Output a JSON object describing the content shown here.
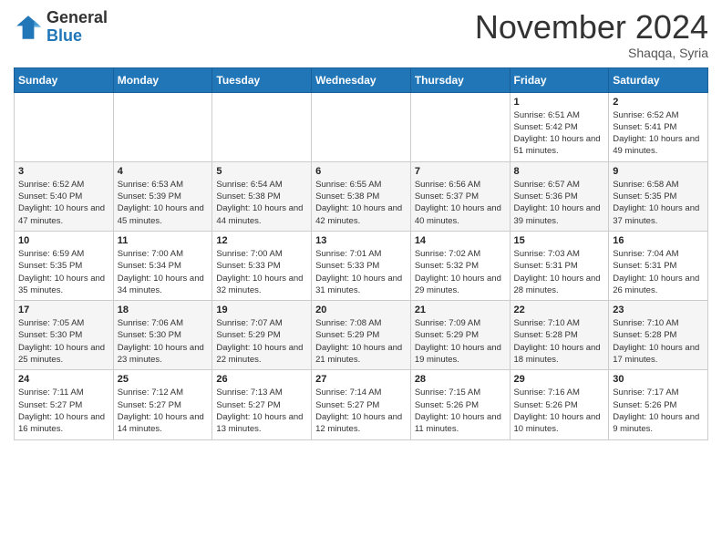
{
  "header": {
    "logo_line1": "General",
    "logo_line2": "Blue",
    "month": "November 2024",
    "location": "Shaqqa, Syria"
  },
  "weekdays": [
    "Sunday",
    "Monday",
    "Tuesday",
    "Wednesday",
    "Thursday",
    "Friday",
    "Saturday"
  ],
  "weeks": [
    [
      null,
      null,
      null,
      null,
      null,
      {
        "day": "1",
        "sunrise": "6:51 AM",
        "sunset": "5:42 PM",
        "daylight": "10 hours and 51 minutes."
      },
      {
        "day": "2",
        "sunrise": "6:52 AM",
        "sunset": "5:41 PM",
        "daylight": "10 hours and 49 minutes."
      }
    ],
    [
      {
        "day": "3",
        "sunrise": "6:52 AM",
        "sunset": "5:40 PM",
        "daylight": "10 hours and 47 minutes."
      },
      {
        "day": "4",
        "sunrise": "6:53 AM",
        "sunset": "5:39 PM",
        "daylight": "10 hours and 45 minutes."
      },
      {
        "day": "5",
        "sunrise": "6:54 AM",
        "sunset": "5:38 PM",
        "daylight": "10 hours and 44 minutes."
      },
      {
        "day": "6",
        "sunrise": "6:55 AM",
        "sunset": "5:38 PM",
        "daylight": "10 hours and 42 minutes."
      },
      {
        "day": "7",
        "sunrise": "6:56 AM",
        "sunset": "5:37 PM",
        "daylight": "10 hours and 40 minutes."
      },
      {
        "day": "8",
        "sunrise": "6:57 AM",
        "sunset": "5:36 PM",
        "daylight": "10 hours and 39 minutes."
      },
      {
        "day": "9",
        "sunrise": "6:58 AM",
        "sunset": "5:35 PM",
        "daylight": "10 hours and 37 minutes."
      }
    ],
    [
      {
        "day": "10",
        "sunrise": "6:59 AM",
        "sunset": "5:35 PM",
        "daylight": "10 hours and 35 minutes."
      },
      {
        "day": "11",
        "sunrise": "7:00 AM",
        "sunset": "5:34 PM",
        "daylight": "10 hours and 34 minutes."
      },
      {
        "day": "12",
        "sunrise": "7:00 AM",
        "sunset": "5:33 PM",
        "daylight": "10 hours and 32 minutes."
      },
      {
        "day": "13",
        "sunrise": "7:01 AM",
        "sunset": "5:33 PM",
        "daylight": "10 hours and 31 minutes."
      },
      {
        "day": "14",
        "sunrise": "7:02 AM",
        "sunset": "5:32 PM",
        "daylight": "10 hours and 29 minutes."
      },
      {
        "day": "15",
        "sunrise": "7:03 AM",
        "sunset": "5:31 PM",
        "daylight": "10 hours and 28 minutes."
      },
      {
        "day": "16",
        "sunrise": "7:04 AM",
        "sunset": "5:31 PM",
        "daylight": "10 hours and 26 minutes."
      }
    ],
    [
      {
        "day": "17",
        "sunrise": "7:05 AM",
        "sunset": "5:30 PM",
        "daylight": "10 hours and 25 minutes."
      },
      {
        "day": "18",
        "sunrise": "7:06 AM",
        "sunset": "5:30 PM",
        "daylight": "10 hours and 23 minutes."
      },
      {
        "day": "19",
        "sunrise": "7:07 AM",
        "sunset": "5:29 PM",
        "daylight": "10 hours and 22 minutes."
      },
      {
        "day": "20",
        "sunrise": "7:08 AM",
        "sunset": "5:29 PM",
        "daylight": "10 hours and 21 minutes."
      },
      {
        "day": "21",
        "sunrise": "7:09 AM",
        "sunset": "5:29 PM",
        "daylight": "10 hours and 19 minutes."
      },
      {
        "day": "22",
        "sunrise": "7:10 AM",
        "sunset": "5:28 PM",
        "daylight": "10 hours and 18 minutes."
      },
      {
        "day": "23",
        "sunrise": "7:10 AM",
        "sunset": "5:28 PM",
        "daylight": "10 hours and 17 minutes."
      }
    ],
    [
      {
        "day": "24",
        "sunrise": "7:11 AM",
        "sunset": "5:27 PM",
        "daylight": "10 hours and 16 minutes."
      },
      {
        "day": "25",
        "sunrise": "7:12 AM",
        "sunset": "5:27 PM",
        "daylight": "10 hours and 14 minutes."
      },
      {
        "day": "26",
        "sunrise": "7:13 AM",
        "sunset": "5:27 PM",
        "daylight": "10 hours and 13 minutes."
      },
      {
        "day": "27",
        "sunrise": "7:14 AM",
        "sunset": "5:27 PM",
        "daylight": "10 hours and 12 minutes."
      },
      {
        "day": "28",
        "sunrise": "7:15 AM",
        "sunset": "5:26 PM",
        "daylight": "10 hours and 11 minutes."
      },
      {
        "day": "29",
        "sunrise": "7:16 AM",
        "sunset": "5:26 PM",
        "daylight": "10 hours and 10 minutes."
      },
      {
        "day": "30",
        "sunrise": "7:17 AM",
        "sunset": "5:26 PM",
        "daylight": "10 hours and 9 minutes."
      }
    ]
  ]
}
